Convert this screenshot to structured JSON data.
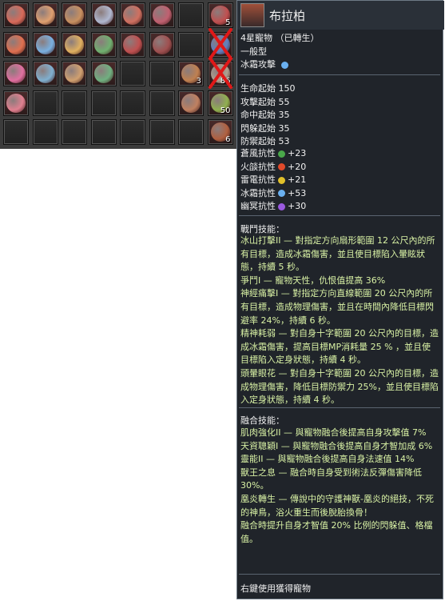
{
  "inventory": {
    "rows": [
      [
        {
          "f": true,
          "c": "#d86a5a"
        },
        {
          "f": true,
          "c": "#e0a070"
        },
        {
          "f": true,
          "c": "#c89060"
        },
        {
          "f": true,
          "c": "#b0b8d0"
        },
        {
          "f": true,
          "c": "#d07060"
        },
        {
          "f": true,
          "c": "#c06070"
        },
        {
          "f": false
        },
        {
          "f": true,
          "c": "#c05050",
          "qty": "5"
        }
      ],
      [
        {
          "f": true,
          "c": "#e07050"
        },
        {
          "f": true,
          "c": "#7ab0e0"
        },
        {
          "f": true,
          "c": "#e0b060"
        },
        {
          "f": true,
          "c": "#70b070"
        },
        {
          "f": true,
          "c": "#c05050"
        },
        {
          "f": true,
          "c": "#a05050"
        },
        {
          "f": false
        },
        {
          "f": true,
          "c": "#6080c0",
          "cross": true
        }
      ],
      [
        {
          "f": true,
          "c": "#e070a0"
        },
        {
          "f": true,
          "c": "#80b0d0"
        },
        {
          "f": true,
          "c": "#d0a070"
        },
        {
          "f": true,
          "c": "#70b080"
        },
        {
          "f": false
        },
        {
          "f": false
        },
        {
          "f": true,
          "c": "#c08050",
          "qty": "3"
        },
        {
          "f": true,
          "c": "#b0a090",
          "qty": "86",
          "cross": true
        }
      ],
      [
        {
          "f": true,
          "c": "#e08090"
        },
        {
          "f": false
        },
        {
          "f": false
        },
        {
          "f": false
        },
        {
          "f": false
        },
        {
          "f": false
        },
        {
          "f": true,
          "c": "#c08060"
        },
        {
          "f": true,
          "c": "#90b050",
          "qty": "50"
        }
      ],
      [
        {
          "f": false
        },
        {
          "f": false
        },
        {
          "f": false
        },
        {
          "f": false
        },
        {
          "f": false
        },
        {
          "f": false
        },
        {
          "f": false
        },
        {
          "f": true,
          "c": "#b06040",
          "qty": "6"
        }
      ]
    ]
  },
  "tooltip": {
    "name": "布拉柏",
    "star_label": "4星寵物 （已轉生）",
    "type": "一般型",
    "attack_type": "冰霜攻擊",
    "stats": [
      {
        "label": "生命起始",
        "value": "150"
      },
      {
        "label": "攻擊起始",
        "value": "55"
      },
      {
        "label": "命中起始",
        "value": "35"
      },
      {
        "label": "閃躲起始",
        "value": "35"
      },
      {
        "label": "防禦起始",
        "value": "53"
      }
    ],
    "resistances": [
      {
        "label": "蒼風抗性",
        "value": "+23",
        "icon": "wind-icon",
        "color": "#4aa84a"
      },
      {
        "label": "火燄抗性",
        "value": "+20",
        "icon": "fire-icon",
        "color": "#e04a2a"
      },
      {
        "label": "雷電抗性",
        "value": "+21",
        "icon": "lightning-icon",
        "color": "#e0c02a"
      },
      {
        "label": "冰霜抗性",
        "value": "+53",
        "icon": "snowflake-icon",
        "color": "#6ab0f0"
      },
      {
        "label": "幽冥抗性",
        "value": "+30",
        "icon": "nether-icon",
        "color": "#9a5ae0"
      }
    ],
    "combat_title": "戰鬥技能：",
    "combat_text": "冰山打擊II — 對指定方向扇形範圍 12 公尺內的所有目標，造成冰霜傷害，並且使目標陷入暈眩狀態，持續 5 秒。\n爭鬥I — 寵物天性，仇恨值提高 36%\n神經痛擊I — 對指定方向直線範圍 20 公尺內的所有目標，造成物理傷害，並且在時間內降低目標閃避率 24%，持續 6 秒。\n精神耗弱 — 對自身十字範圍 20 公尺內的目標，造成冰霜傷害，提高目標MP消耗量 25 % ，並且使目標陷入定身狀態，持續 4 秒。\n頭暈眼花 — 對自身十字範圍 20 公尺內的目標，造成物理傷害，降低目標防禦力 25%，並且使目標陷入定身狀態，持續 4 秒。",
    "fusion_title": "融合技能：",
    "fusion_text": "肌肉強化II — 與寵物融合後提高自身攻擊值 7%\n天資聰穎I — 與寵物融合後提高自身才智加成 6%\n靈能II — 與寵物融合後提高自身法速值 14%\n獸王之息 — 融合時自身受到術法反彈傷害降低 30%。\n凰炎轉生 — 傳說中的守護神獸-凰炎的絕技，不死的神鳥，浴火重生而後脫胎換骨！\n融合時提升自身才智值 20% 比例的閃躲值、格檔值。",
    "footer": "右鍵使用獲得寵物"
  }
}
